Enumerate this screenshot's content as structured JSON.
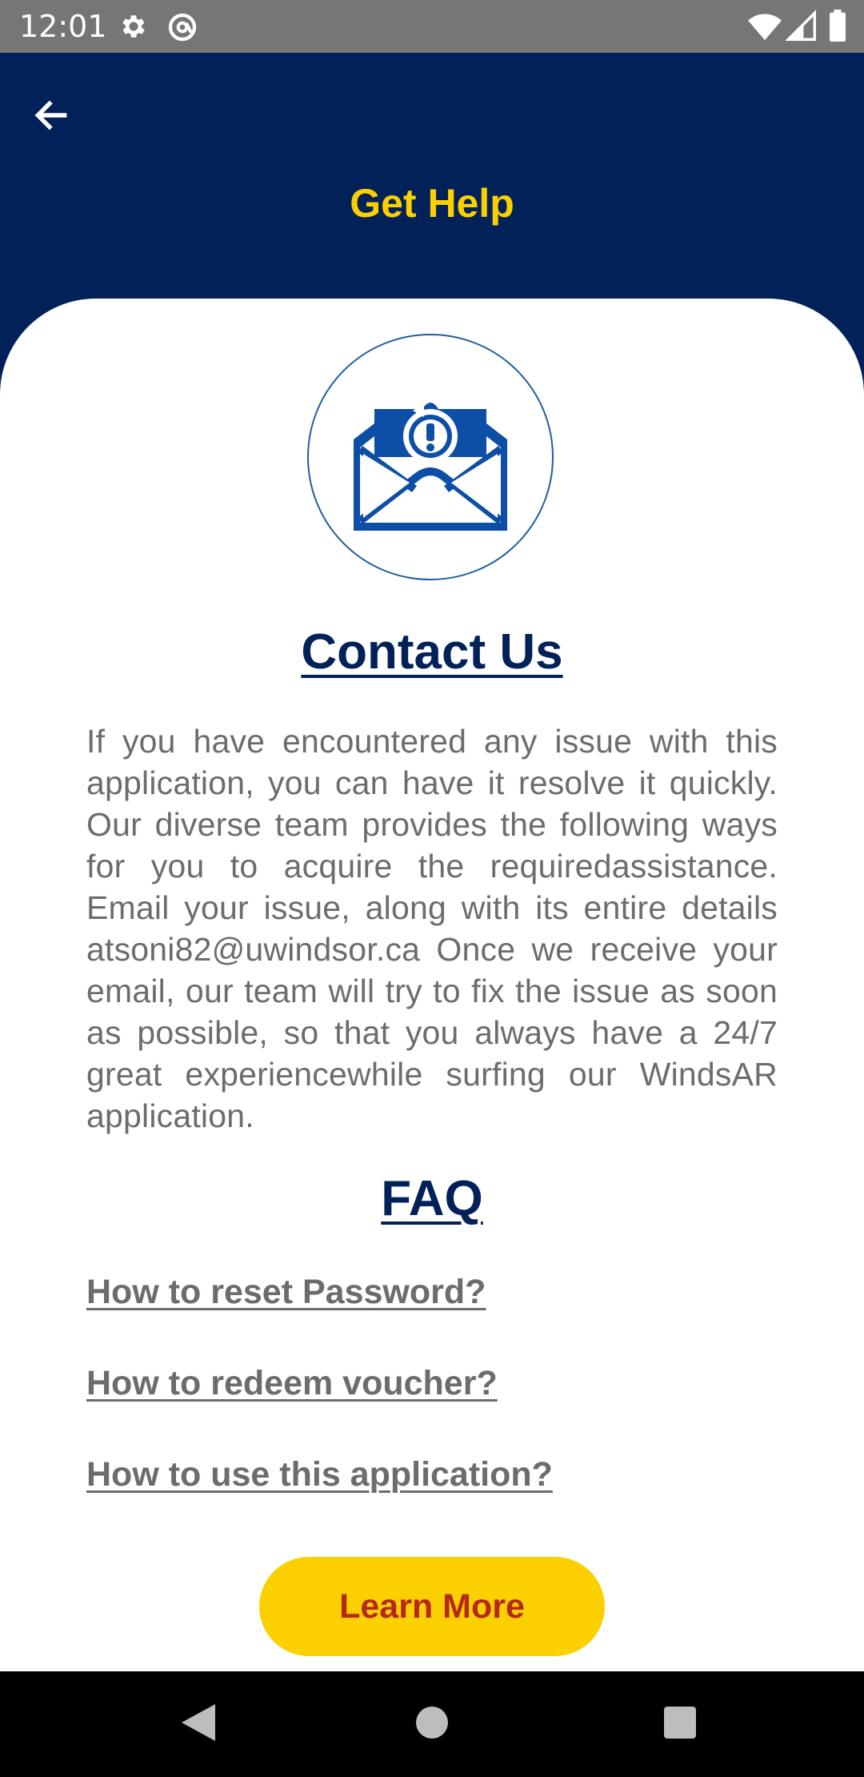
{
  "status_bar": {
    "time": "12:01",
    "icons": [
      "settings-gear-icon",
      "at-sign-icon",
      "wifi-icon",
      "cell-signal-icon",
      "battery-icon"
    ]
  },
  "app_bar": {
    "back_icon": "arrow-left-icon",
    "title": "Get Help"
  },
  "colors": {
    "primary_navy": "#012158",
    "accent_yellow": "#fcd000",
    "button_text_red": "#b5281c",
    "body_gray": "#6c6c6c",
    "icon_blue": "#0d4ea6"
  },
  "contact": {
    "hero_icon": "email-alert-icon",
    "heading": "Contact Us",
    "body": "If you have encountered any issue with this application, you can have it resolve it quickly. Our diverse team provides the following ways for you to acquire the requiredassistance. Email your issue, along with its entire details atsoni82@uwindsor.ca Once we receive your email, our team will try to fix the issue as soon as possible, so that you always have a 24/7 great experiencewhile surfing our WindsAR application."
  },
  "faq": {
    "heading": "FAQ",
    "items": [
      {
        "label": "How to reset Password?"
      },
      {
        "label": "How to redeem voucher?"
      },
      {
        "label": "How to use this application?"
      }
    ]
  },
  "learn_more": {
    "label": "Learn More"
  },
  "nav_bar": {
    "icons": [
      "nav-back-icon",
      "nav-home-icon",
      "nav-recents-icon"
    ]
  }
}
